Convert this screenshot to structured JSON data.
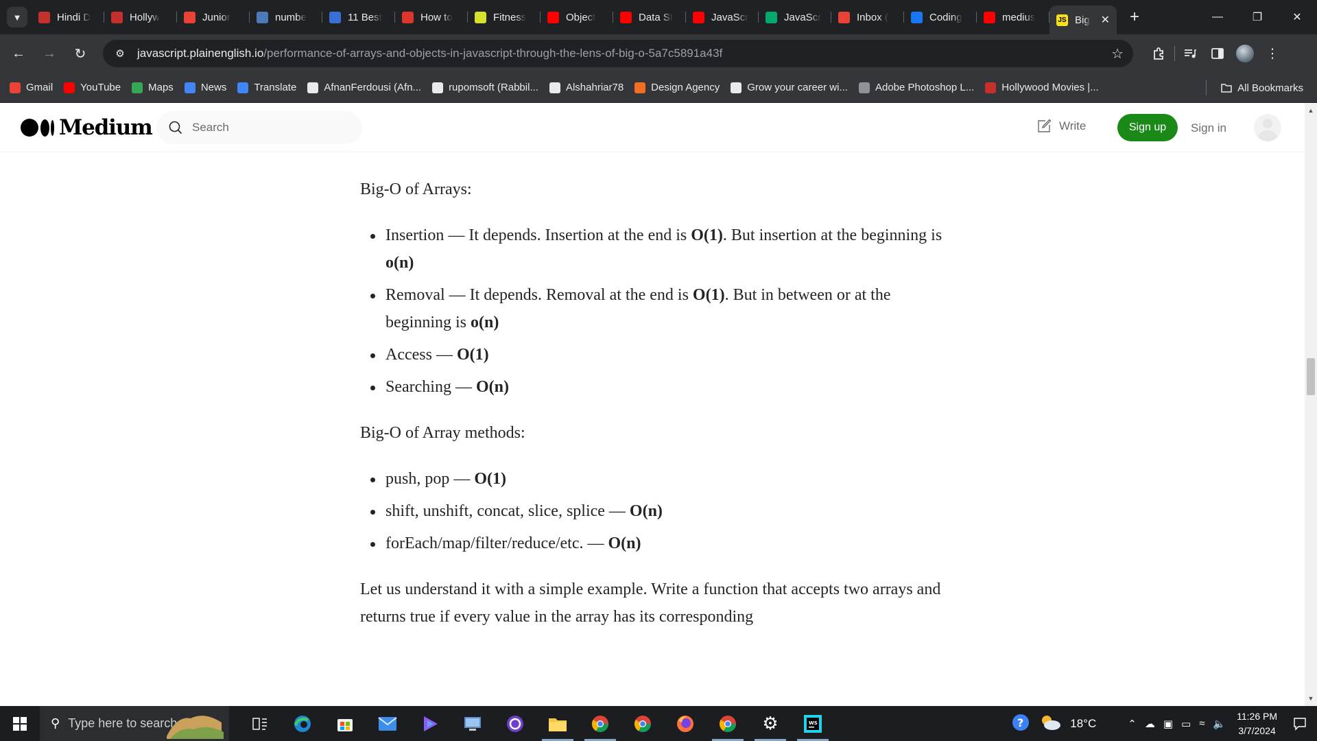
{
  "browser": {
    "tabs": [
      {
        "title": "Hindi D",
        "favicon": "hollywood-icon",
        "color": "#c4302b"
      },
      {
        "title": "Hollyw",
        "favicon": "hollywood-icon",
        "color": "#c4302b"
      },
      {
        "title": "Junior",
        "favicon": "gmail-icon",
        "color": "#ea4335"
      },
      {
        "title": "numbe",
        "favicon": "notion-icon",
        "color": "#4a7ab8"
      },
      {
        "title": "11 Best",
        "favicon": "w-icon",
        "color": "#3b6fd8"
      },
      {
        "title": "How to",
        "favicon": "b-icon",
        "color": "#e0352b"
      },
      {
        "title": "Fitness",
        "favicon": "arrows-icon",
        "color": "#d7e02b"
      },
      {
        "title": "Object",
        "favicon": "youtube-icon",
        "color": "#ff0000"
      },
      {
        "title": "Data St",
        "favicon": "youtube-icon",
        "color": "#ff0000"
      },
      {
        "title": "JavaScr",
        "favicon": "youtube-icon",
        "color": "#ff0000"
      },
      {
        "title": "JavaScr",
        "favicon": "w3-icon",
        "color": "#04aa6d"
      },
      {
        "title": "Inbox (",
        "favicon": "gmail-icon",
        "color": "#ea4335"
      },
      {
        "title": "Coding",
        "favicon": "facebook-icon",
        "color": "#1877f2"
      },
      {
        "title": "medius",
        "favicon": "youtube-icon",
        "color": "#ff0000"
      }
    ],
    "active_tab": {
      "title": "Big",
      "favicon_text": "JS"
    },
    "url_host": "javascript.plainenglish.io",
    "url_path": "/performance-of-arrays-and-objects-in-javascript-through-the-lens-of-big-o-5a7c5891a43f",
    "bookmarks": [
      {
        "label": "Gmail",
        "icon": "gmail-icon",
        "color": "#ea4335"
      },
      {
        "label": "YouTube",
        "icon": "youtube-icon",
        "color": "#ff0000"
      },
      {
        "label": "Maps",
        "icon": "maps-icon",
        "color": "#34a853"
      },
      {
        "label": "News",
        "icon": "news-icon",
        "color": "#4285f4"
      },
      {
        "label": "Translate",
        "icon": "translate-icon",
        "color": "#4285f4"
      },
      {
        "label": "AfnanFerdousi (Afn...",
        "icon": "github-icon",
        "color": "#e8eaed"
      },
      {
        "label": "rupomsoft (Rabbil...",
        "icon": "github-icon",
        "color": "#e8eaed"
      },
      {
        "label": "Alshahriar78",
        "icon": "github-icon",
        "color": "#e8eaed"
      },
      {
        "label": "Design Agency",
        "icon": "design-icon",
        "color": "#f26f21"
      },
      {
        "label": "Grow your career wi...",
        "icon": "career-icon",
        "color": "#e8eaed"
      },
      {
        "label": "Adobe Photoshop L...",
        "icon": "folder-icon",
        "color": "#8e9195"
      },
      {
        "label": "Hollywood Movies |...",
        "icon": "hollywood-icon",
        "color": "#c4302b"
      }
    ],
    "all_bookmarks": "All Bookmarks"
  },
  "medium": {
    "logo": "Medium",
    "search_placeholder": "Search",
    "write": "Write",
    "signup": "Sign up",
    "signin": "Sign in",
    "brand_color": "#1a8917"
  },
  "article": {
    "heading1": "Big-O of Arrays:",
    "array_ops": [
      {
        "text": "Insertion — It depends. Insertion at the end is ",
        "b1": "O(1)",
        "text2": ". But insertion at the beginning is ",
        "b2": "o(n)"
      },
      {
        "text": "Removal — It depends. Removal at the end is ",
        "b1": "O(1)",
        "text2": ". But in between or at the beginning is ",
        "b2": "o(n)"
      },
      {
        "text": "Access — ",
        "b1": "O(1)",
        "text2": "",
        "b2": ""
      },
      {
        "text": "Searching — ",
        "b1": "O(n)",
        "text2": "",
        "b2": ""
      }
    ],
    "heading2": "Big-O of Array methods:",
    "method_ops": [
      {
        "text": "push, pop — ",
        "b1": "O(1)"
      },
      {
        "text": "shift, unshift, concat, slice, splice — ",
        "b1": "O(n)"
      },
      {
        "text": "forEach/map/filter/reduce/etc. — ",
        "b1": "O(n)"
      }
    ],
    "paragraph": "Let us understand it with a simple example. Write a function that accepts two arrays and returns true if every value in the array has its corresponding"
  },
  "taskbar": {
    "search_placeholder": "Type here to search",
    "weather": "18°C",
    "time": "11:26 PM",
    "date": "3/7/2024"
  }
}
